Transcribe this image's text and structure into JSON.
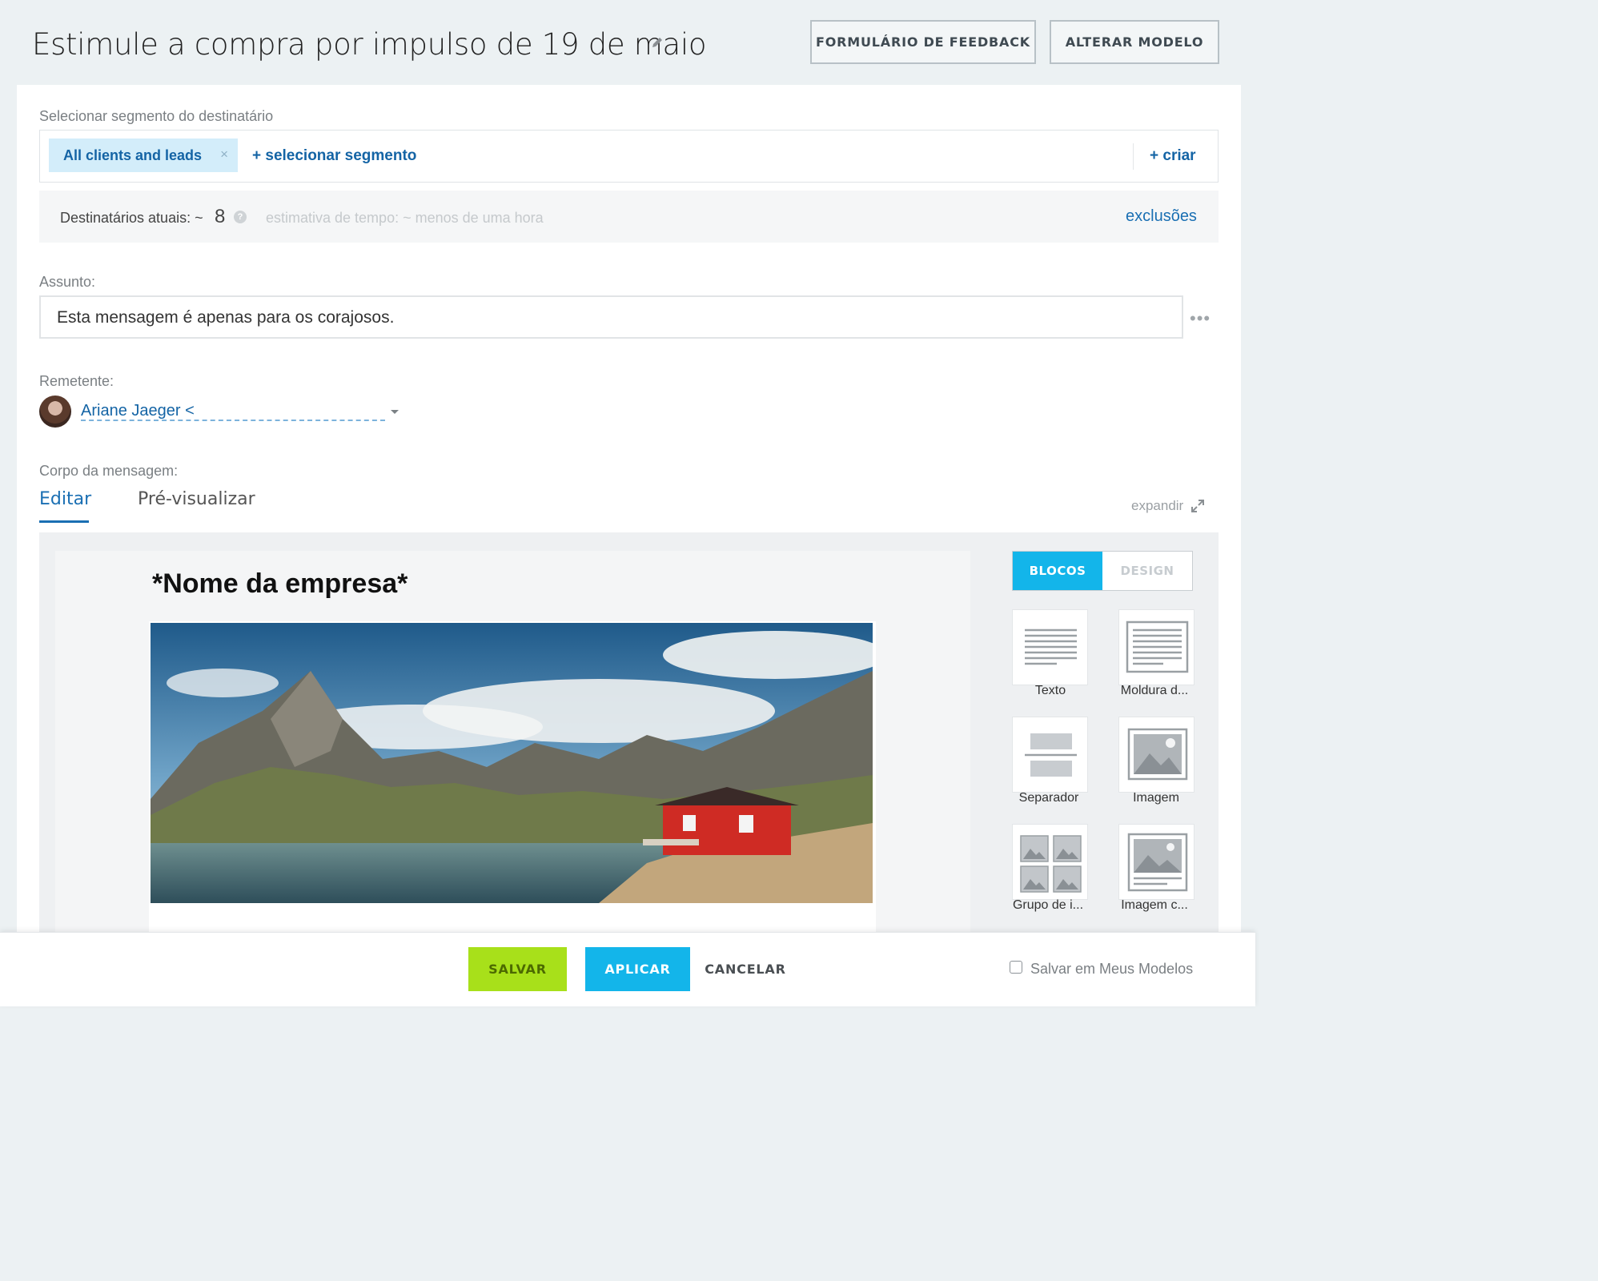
{
  "header": {
    "title": "Estimule a compra por impulso de 19 de maio",
    "feedback_button": "FORMULÁRIO DE FEEDBACK",
    "change_template_button": "ALTERAR MODELO"
  },
  "recipients": {
    "segment_label": "Selecionar segmento do destinatário",
    "selected_segment": "All clients and leads",
    "select_segment_link": "+ selecionar segmento",
    "create_link": "+ criar",
    "current_label": "Destinatários atuais: ~",
    "current_count": "8",
    "time_estimate": "estimativa de tempo: ~ menos de uma hora",
    "exclusions_link": "exclusões"
  },
  "subject": {
    "label": "Assunto:",
    "value": "Esta mensagem é apenas para os corajosos."
  },
  "sender": {
    "label": "Remetente:",
    "value": "Ariane Jaeger <"
  },
  "body": {
    "label": "Corpo da mensagem:",
    "tab_edit": "Editar",
    "tab_preview": "Pré-visualizar",
    "expand_label": "expandir"
  },
  "editor": {
    "company_name": "*Nome da empresa*",
    "tab_blocks": "BLOCOS",
    "tab_design": "DESIGN",
    "blocks": [
      "Texto",
      "Moldura d...",
      "Separador",
      "Imagem",
      "Grupo de i...",
      "Imagem c..."
    ]
  },
  "footer": {
    "save": "SALVAR",
    "apply": "APLICAR",
    "cancel": "CANCELAR",
    "save_to_templates": "Salvar em Meus Modelos"
  },
  "colors": {
    "accent_blue": "#1464a5",
    "cyan": "#13b5ea",
    "green": "#a8e01a"
  }
}
